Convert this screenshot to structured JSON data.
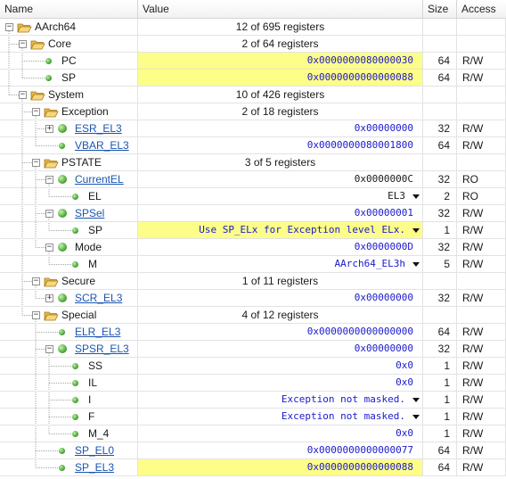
{
  "columns": {
    "name": "Name",
    "value": "Value",
    "size": "Size",
    "access": "Access"
  },
  "icons": {
    "folder": "folder-open-icon",
    "register": "register-icon",
    "field": "field-icon",
    "expand": "expand-icon",
    "collapse": "collapse-icon",
    "dropdown": "dropdown-arrow-icon"
  },
  "colors": {
    "highlight": "#fdfd8a",
    "value_text": "#1a1acc",
    "link_text": "#1a55b0"
  },
  "rows": [
    {
      "name": "AArch64",
      "value": "12 of 695 registers",
      "size": "",
      "access": ""
    },
    {
      "name": "Core",
      "value": "2 of 64 registers",
      "size": "",
      "access": ""
    },
    {
      "name": "PC",
      "value": "0x0000000080000030",
      "size": "64",
      "access": "R/W"
    },
    {
      "name": "SP",
      "value": "0x0000000000000088",
      "size": "64",
      "access": "R/W"
    },
    {
      "name": "System",
      "value": "10 of 426 registers",
      "size": "",
      "access": ""
    },
    {
      "name": "Exception",
      "value": "2 of 18 registers",
      "size": "",
      "access": ""
    },
    {
      "name": "ESR_EL3",
      "value": "0x00000000",
      "size": "32",
      "access": "R/W"
    },
    {
      "name": "VBAR_EL3",
      "value": "0x0000000080001800",
      "size": "64",
      "access": "R/W"
    },
    {
      "name": "PSTATE",
      "value": "3 of 5 registers",
      "size": "",
      "access": ""
    },
    {
      "name": "CurrentEL",
      "value": "0x0000000C",
      "size": "32",
      "access": "RO"
    },
    {
      "name": "EL",
      "value": "EL3",
      "size": "2",
      "access": "RO"
    },
    {
      "name": "SPSel",
      "value": "0x00000001",
      "size": "32",
      "access": "R/W"
    },
    {
      "name": "SP",
      "value": "Use SP_ELx for Exception level ELx.",
      "size": "1",
      "access": "R/W"
    },
    {
      "name": "Mode",
      "value": "0x0000000D",
      "size": "32",
      "access": "R/W"
    },
    {
      "name": "M",
      "value": "AArch64_EL3h",
      "size": "5",
      "access": "R/W"
    },
    {
      "name": "Secure",
      "value": "1 of 11 registers",
      "size": "",
      "access": ""
    },
    {
      "name": "SCR_EL3",
      "value": "0x00000000",
      "size": "32",
      "access": "R/W"
    },
    {
      "name": "Special",
      "value": "4 of 12 registers",
      "size": "",
      "access": ""
    },
    {
      "name": "ELR_EL3",
      "value": "0x0000000000000000",
      "size": "64",
      "access": "R/W"
    },
    {
      "name": "SPSR_EL3",
      "value": "0x00000000",
      "size": "32",
      "access": "R/W"
    },
    {
      "name": "SS",
      "value": "0x0",
      "size": "1",
      "access": "R/W"
    },
    {
      "name": "IL",
      "value": "0x0",
      "size": "1",
      "access": "R/W"
    },
    {
      "name": "I",
      "value": "Exception not masked.",
      "size": "1",
      "access": "R/W"
    },
    {
      "name": "F",
      "value": "Exception not masked.",
      "size": "1",
      "access": "R/W"
    },
    {
      "name": "M_4",
      "value": "0x0",
      "size": "1",
      "access": "R/W"
    },
    {
      "name": "SP_EL0",
      "value": "0x0000000000000077",
      "size": "64",
      "access": "R/W"
    },
    {
      "name": "SP_EL3",
      "value": "0x0000000000000088",
      "size": "64",
      "access": "R/W"
    }
  ]
}
